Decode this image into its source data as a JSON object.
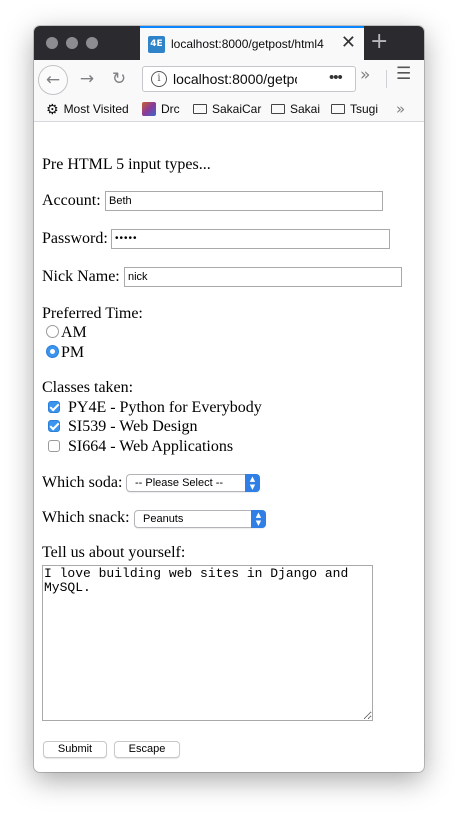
{
  "browser": {
    "tab": {
      "favicon": "4E",
      "title": "localhost:8000/getpost/html4"
    },
    "url": "localhost:8000/getpost/html4",
    "bookmarks": [
      "Most Visited",
      "Drc",
      "SakaiCar",
      "Sakai",
      "Tsugi"
    ]
  },
  "page": {
    "heading": "Pre HTML 5 input types...",
    "account": {
      "label": "Account:",
      "value": "Beth"
    },
    "password": {
      "label": "Password:",
      "value": "•••••"
    },
    "nick": {
      "label": "Nick Name:",
      "value": "nick"
    },
    "time": {
      "label": "Preferred Time:",
      "options": [
        {
          "label": "AM",
          "checked": false
        },
        {
          "label": "PM",
          "checked": true
        }
      ]
    },
    "classes": {
      "label": "Classes taken:",
      "items": [
        {
          "label": "PY4E - Python for Everybody",
          "checked": true
        },
        {
          "label": "SI539 - Web Design",
          "checked": true
        },
        {
          "label": "SI664 - Web Applications",
          "checked": false
        }
      ]
    },
    "soda": {
      "label": "Which soda:",
      "selected": "-- Please Select --"
    },
    "snack": {
      "label": "Which snack:",
      "selected": "Peanuts"
    },
    "about": {
      "label": "Tell us about yourself:",
      "value": "I love building web sites in Django and MySQL."
    },
    "buttons": {
      "submit": "Submit",
      "escape": "Escape"
    }
  }
}
